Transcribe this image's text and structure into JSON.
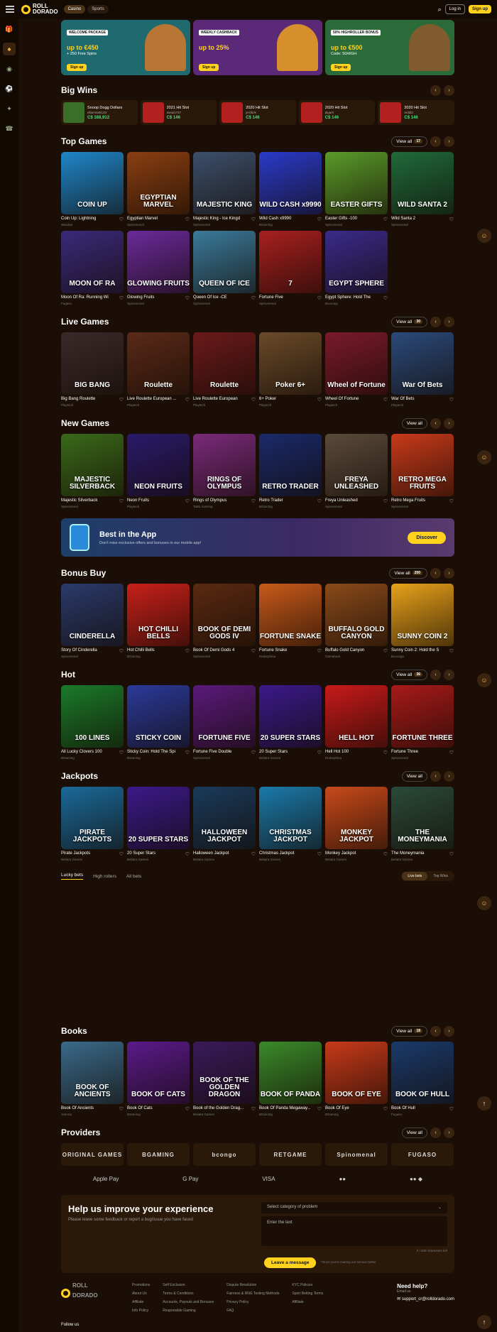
{
  "header": {
    "logo_top": "ROLL",
    "logo_bottom": "DORADO",
    "tabs": [
      "Casino",
      "Sports"
    ],
    "login": "Log in",
    "signup": "Sign up"
  },
  "promos": [
    {
      "tag": "WELCOME PACKAGE",
      "big": "up to €450",
      "small": "+ 250 Free Spins",
      "cta": "Sign up",
      "bg": "#1f6a6e",
      "art": "#c9772c"
    },
    {
      "tag": "WEEKLY CASHBACK",
      "big": "up to 25%",
      "small": "",
      "cta": "Sign up",
      "bg": "#5a2a78",
      "art": "#e39a23"
    },
    {
      "tag": "50% HIGHROLLER BONUS",
      "big": "up to €500",
      "small": "Code: 50HIGH",
      "cta": "Sign up",
      "bg": "#2b6b3a",
      "art": "#8a5a2c"
    }
  ],
  "big_wins": {
    "title": "Big Wins",
    "items": [
      {
        "game": "Snoop Dogg Dollars",
        "user": "ellamirat5123",
        "amount": "C$ 188,912",
        "color": "#3a6f2a"
      },
      {
        "game": "2021 Hit Slot",
        "user": "assai1747",
        "amount": "C$ 146",
        "color": "#b32020"
      },
      {
        "game": "2020 Hit Slot",
        "user": "jerdrick",
        "amount": "C$ 146",
        "color": "#b32020"
      },
      {
        "game": "2020 Hit Slot",
        "user": "plgarti",
        "amount": "C$ 146",
        "color": "#b32020"
      },
      {
        "game": "2020 Hit Slot",
        "user": "reddl2",
        "amount": "C$ 146",
        "color": "#b32020"
      }
    ]
  },
  "sections": [
    {
      "title": "Top Games",
      "view_all": "View all",
      "count": "17",
      "rows": [
        [
          {
            "name": "Coin Up: Lightning",
            "provider": "Wazdan",
            "art": "COIN UP",
            "bg": "#1f86c9"
          },
          {
            "name": "Egyptian Marvel",
            "provider": "Spinomenal",
            "art": "EGYPTIAN MARVEL",
            "bg": "#8a3f12"
          },
          {
            "name": "Majestic King - Ice Kingd",
            "provider": "Spinomenal",
            "art": "MAJESTIC KING",
            "bg": "#3c4f6b"
          },
          {
            "name": "Wild Cash x9990",
            "provider": "BGaming",
            "art": "WILD CASH x9990",
            "bg": "#2a3ac9"
          },
          {
            "name": "Easter Gifts -100",
            "provider": "Spinomenal",
            "art": "EASTER GIFTS",
            "bg": "#5a9a2a"
          },
          {
            "name": "Wild Santa 2",
            "provider": "Spinomenal",
            "art": "WILD SANTA 2",
            "bg": "#1f6a3a"
          }
        ],
        [
          {
            "name": "Moon Of Ra: Running Wi",
            "provider": "Fugaso",
            "art": "MOON OF RA",
            "bg": "#3a2a7a"
          },
          {
            "name": "Glowing Fruits",
            "provider": "Spinomenal",
            "art": "GLOWING FRUITS",
            "bg": "#6a2a9a"
          },
          {
            "name": "Queen Of Ice -CE",
            "provider": "Spinomenal",
            "art": "QUEEN OF ICE",
            "bg": "#3a7a9a"
          },
          {
            "name": "Fortune Five",
            "provider": "Spinomenal",
            "art": "7",
            "bg": "#a82020"
          },
          {
            "name": "Egypt Sphere: Hold The ",
            "provider": "Booongo",
            "art": "EGYPT SPHERE",
            "bg": "#3a2a8a"
          }
        ]
      ]
    },
    {
      "title": "Live Games",
      "view_all": "View all",
      "count": "30",
      "rows": [
        [
          {
            "name": "Big Bang Roulette",
            "provider": "Playtech",
            "art": "BIG BANG",
            "bg": "#3a2a2a"
          },
          {
            "name": "Live Roulette European ...",
            "provider": "Playtech",
            "art": "Roulette",
            "bg": "#5a2a18"
          },
          {
            "name": "Live Roulette European",
            "provider": "Playtech",
            "art": "Roulette",
            "bg": "#6a1a1a"
          },
          {
            "name": "6+ Poker",
            "provider": "Playtech",
            "art": "Poker 6+",
            "bg": "#6a4a2a"
          },
          {
            "name": "Wheel Of Fortune",
            "provider": "Playtech",
            "art": "Wheel of Fortune",
            "bg": "#7a1a2a"
          },
          {
            "name": "War Of Bets",
            "provider": "Playtech",
            "art": "War Of Bets",
            "bg": "#2a4a7a"
          }
        ]
      ]
    },
    {
      "title": "New Games",
      "view_all": "View all",
      "count": "",
      "rows": [
        [
          {
            "name": "Majestic Silverback",
            "provider": "Spinomenal",
            "art": "MAJESTIC SILVERBACK",
            "bg": "#3a6a1a"
          },
          {
            "name": "Neon Fruits",
            "provider": "Playtech",
            "art": "NEON FRUITS",
            "bg": "#2a1a6a"
          },
          {
            "name": "Rings of Olympus",
            "provider": "TaDa Gaming",
            "art": "RINGS OF OLYMPUS",
            "bg": "#7a2a7a"
          },
          {
            "name": "Retro Trader",
            "provider": "BGaming",
            "art": "RETRO TRADER",
            "bg": "#1a2a6a"
          },
          {
            "name": "Freya Unleashed",
            "provider": "Spinomenal",
            "art": "FREYA UNLEASHED",
            "bg": "#5a4a3a"
          },
          {
            "name": "Retro Mega Fruits",
            "provider": "Spinomenal",
            "art": "RETRO MEGA FRUITS",
            "bg": "#c83a1a"
          }
        ]
      ]
    }
  ],
  "app_banner": {
    "title": "Best in the App",
    "subtitle": "Don't miss exclusive offers and bonuses in our mobile app!",
    "cta": "Discover"
  },
  "sections2": [
    {
      "title": "Bonus Buy",
      "view_all": "View all",
      "count": "200",
      "rows": [
        [
          {
            "name": "Story Of Cinderella",
            "provider": "Spinomenal",
            "art": "CINDERELLA",
            "bg": "#2a3a6a"
          },
          {
            "name": "Hot Chilli Bells",
            "provider": "BGaming",
            "art": "HOT CHILLI BELLS",
            "bg": "#c8201a"
          },
          {
            "name": "Book Of Demi Gods 4",
            "provider": "Spinomenal",
            "art": "BOOK OF DEMI GODS IV",
            "bg": "#5a2a12"
          },
          {
            "name": "Fortune Snake",
            "provider": "Endorphina",
            "art": "FORTUNE SNAKE",
            "bg": "#c85a1a"
          },
          {
            "name": "Buffalo Gold Canyon",
            "provider": "Gamebeat",
            "art": "BUFFALO GOLD CANYON",
            "bg": "#8a4a1a"
          },
          {
            "name": "Sunny Coin 2: Hold the S",
            "provider": "Booongo",
            "art": "SUNNY COIN 2",
            "bg": "#e8a21a"
          }
        ]
      ]
    },
    {
      "title": "Hot",
      "view_all": "View all",
      "count": "36",
      "rows": [
        [
          {
            "name": "All Lucky Clovers 100",
            "provider": "BGaming",
            "art": "100 LINES",
            "bg": "#1a7a2a"
          },
          {
            "name": "Sticky Coin: Hold The Spi",
            "provider": "BGaming",
            "art": "STICKY COIN",
            "bg": "#2a3a9a"
          },
          {
            "name": "Fortune Five Double",
            "provider": "Spinomenal",
            "art": "FORTUNE FIVE",
            "bg": "#5a1a7a"
          },
          {
            "name": "20 Super Stars",
            "provider": "Belatra Games",
            "art": "20 SUPER STARS",
            "bg": "#3a1a8a"
          },
          {
            "name": "Hell Hot 100",
            "provider": "Endorphina",
            "art": "HELL HOT",
            "bg": "#c81a1a"
          },
          {
            "name": "Fortune Three",
            "provider": "Spinomenal",
            "art": "FORTUNE THREE",
            "bg": "#a81a1a"
          }
        ]
      ]
    },
    {
      "title": "Jackpots",
      "view_all": "View all",
      "count": "",
      "rows": [
        [
          {
            "name": "Pirate Jackpots",
            "provider": "Belatra Games",
            "art": "PIRATE JACKPOTS",
            "bg": "#1a6a9a"
          },
          {
            "name": "20 Super Stars",
            "provider": "Belatra Games",
            "art": "20 SUPER STARS",
            "bg": "#3a1a8a"
          },
          {
            "name": "Halloween Jackpot",
            "provider": "Belatra Games",
            "art": "HALLOWEEN JACKPOT",
            "bg": "#1a3a5a"
          },
          {
            "name": "Christmas Jackpot",
            "provider": "Belatra Games",
            "art": "CHRISTMAS JACKPOT",
            "bg": "#1a7aaa"
          },
          {
            "name": "Monkey Jackpot",
            "provider": "Belatra Games",
            "art": "MONKEY JACKPOT",
            "bg": "#c84a1a"
          },
          {
            "name": "The Moneymania",
            "provider": "Belatra Games",
            "art": "THE MONEYMANIA",
            "bg": "#2a4a3a"
          }
        ]
      ]
    }
  ],
  "bets": {
    "tabs": [
      "Lucky bets",
      "High rollers",
      "All bets"
    ],
    "switch": [
      "Live bets",
      "Top Wins"
    ]
  },
  "books": {
    "title": "Books",
    "view_all": "View all",
    "count": "18",
    "rows": [
      [
        {
          "name": "Book Of Ancients",
          "provider": "Gamzix",
          "art": "BOOK OF ANCIENTS",
          "bg": "#3a6a8a"
        },
        {
          "name": "Book Of Cats",
          "provider": "BGaming",
          "art": "BOOK OF CATS",
          "bg": "#5a1a8a"
        },
        {
          "name": "Book of the Golden Drag...",
          "provider": "Belatra Games",
          "art": "BOOK OF THE GOLDEN DRAGON",
          "bg": "#3a1a5a"
        },
        {
          "name": "Book Of Panda Megaway...",
          "provider": "BGaming",
          "art": "BOOK OF PANDA",
          "bg": "#3a8a2a"
        },
        {
          "name": "Book Of Eye",
          "provider": "BGaming",
          "art": "BOOK OF EYE",
          "bg": "#c83a1a"
        },
        {
          "name": "Book Of Hull",
          "provider": "Fugaso",
          "art": "BOOK OF HULL",
          "bg": "#1a3a6a"
        }
      ]
    ]
  },
  "providers": {
    "title": "Providers",
    "view_all": "View all",
    "count": "",
    "items": [
      "ORIGINAL GAMES",
      "BGAMING",
      "bcongo",
      "RETGAME",
      "Spinomenal",
      "FUGASO"
    ]
  },
  "payments": [
    "Apple Pay",
    "G Pay",
    "VISA",
    "●●",
    "●● ◆"
  ],
  "feedback": {
    "title": "Help us improve your experience",
    "sub": "Please leave some feedback or report a bug/issue you have faced",
    "select_ph": "Select category of problem",
    "text_ph": "Enter the text",
    "count": "0 / 500 characters left",
    "send": "Leave a message",
    "note": "*Once you're making our service better"
  },
  "footer": {
    "follow": "Follow us",
    "cols": [
      [
        "Promotions",
        "About Us",
        "Affiliate",
        "Info Policy"
      ],
      [
        "Self Exclusion",
        "Terms & Conditions",
        "Accounts, Payouts and Bonuses",
        "Responsible Gaming"
      ],
      [
        "Dispute Resolution",
        "Fairness & RNG Testing Methods",
        "Privacy Policy",
        "FAQ"
      ],
      [
        "KYC Policies",
        "Sport Betting Terms",
        "Affiliate"
      ]
    ],
    "help_title": "Need help?",
    "email_label": "Email us",
    "email": "support_cr@rolldorado.com"
  }
}
